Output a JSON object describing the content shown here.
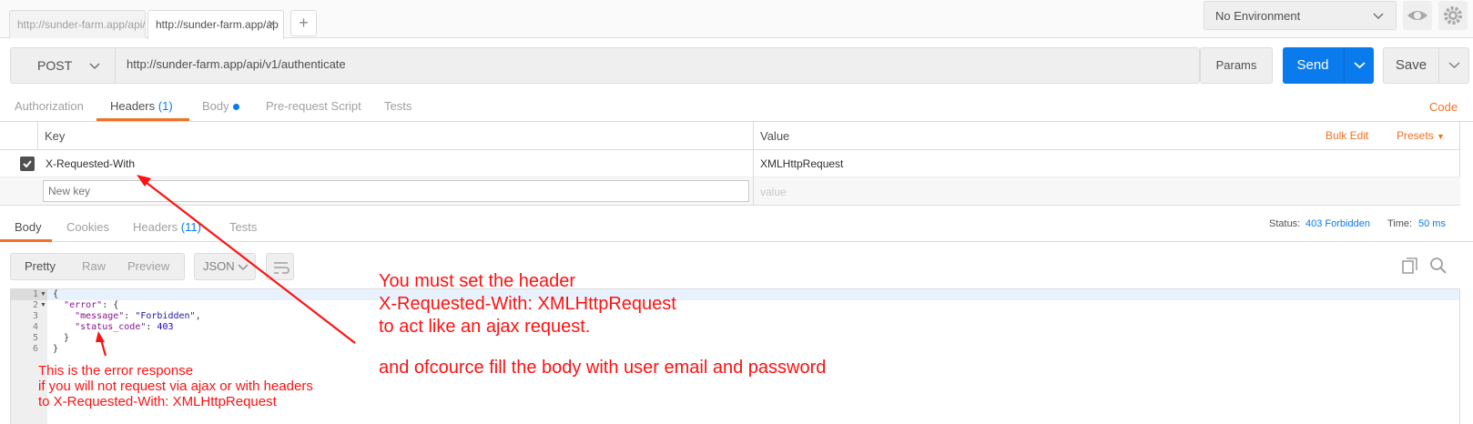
{
  "tabs": [
    {
      "label": "http://sunder-farm.app/api/"
    },
    {
      "label": "http://sunder-farm.app/ap"
    }
  ],
  "env": {
    "selected": "No Environment"
  },
  "request": {
    "method": "POST",
    "url": "http://sunder-farm.app/api/v1/authenticate",
    "params_label": "Params",
    "send_label": "Send",
    "save_label": "Save"
  },
  "request_tabs": {
    "authorization": "Authorization",
    "headers": "Headers",
    "headers_count": "(1)",
    "body": "Body",
    "prerequest": "Pre-request Script",
    "tests": "Tests",
    "code": "Code"
  },
  "headers_table": {
    "key_col": "Key",
    "value_col": "Value",
    "bulk_edit": "Bulk Edit",
    "presets": "Presets",
    "rows": [
      {
        "key": "X-Requested-With",
        "value": "XMLHttpRequest"
      }
    ],
    "new_key_placeholder": "New key",
    "new_value_placeholder": "value"
  },
  "response_tabs": {
    "body": "Body",
    "cookies": "Cookies",
    "headers": "Headers",
    "headers_count": "(11)",
    "tests": "Tests"
  },
  "response_meta": {
    "status_label": "Status:",
    "status_value": "403 Forbidden",
    "time_label": "Time:",
    "time_value": "50 ms"
  },
  "viewer": {
    "pretty": "Pretty",
    "raw": "Raw",
    "preview": "Preview",
    "format": "JSON"
  },
  "code_lines": [
    {
      "n": "1",
      "text": "{"
    },
    {
      "n": "2",
      "key": "\"error\"",
      "rest": ": {"
    },
    {
      "n": "3",
      "key": "\"message\"",
      "sep": ": ",
      "str": "\"Forbidden\"",
      "end": ","
    },
    {
      "n": "4",
      "key": "\"status_code\"",
      "sep": ": ",
      "num": "403"
    },
    {
      "n": "5",
      "text": "  }"
    },
    {
      "n": "6",
      "text": "}"
    }
  ],
  "annotations": {
    "main_1": "You must set the header",
    "main_2": "X-Requested-With: XMLHttpRequest",
    "main_3": "to act like an ajax request.",
    "main_4": "and ofcource fill the body with user email and password",
    "small_1": "This is the error response",
    "small_2": "if you will not request via ajax or with headers",
    "small_3": "to X-Requested-With: XMLHttpRequest"
  }
}
